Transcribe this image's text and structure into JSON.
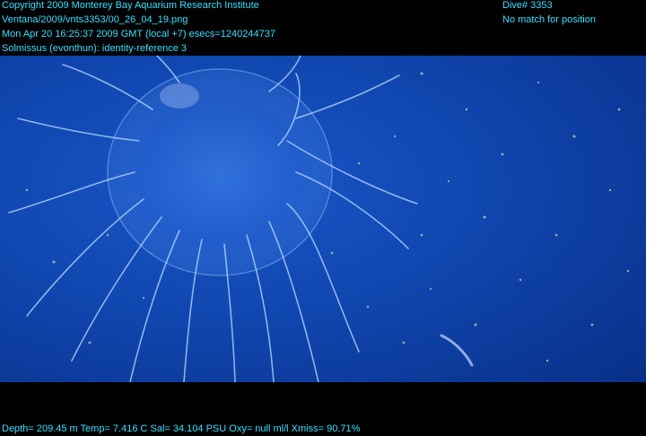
{
  "header": {
    "line1": "Copyright 2009 Monterey Bay Aquarium Research Institute",
    "line2": "Ventana/2009/vnts3353/00_26_04_19.png",
    "line3": "Mon Apr 20 16:25:37 2009 GMT (local +7)  esecs=1240244737",
    "line4": "Solmissus (evonthun): identity-reference 3",
    "dive": "Dive# 3353",
    "position": "No match for position"
  },
  "footer": {
    "telemetry": "Depth= 209.45 m  Temp= 7.416 C  Sal= 34.104 PSU  Oxy= null ml/l  Xmiss= 90.71%"
  },
  "scene": {
    "subject": "jellyfish",
    "background_color": "#0d3c9e",
    "accent_color": "#39e0ff"
  }
}
